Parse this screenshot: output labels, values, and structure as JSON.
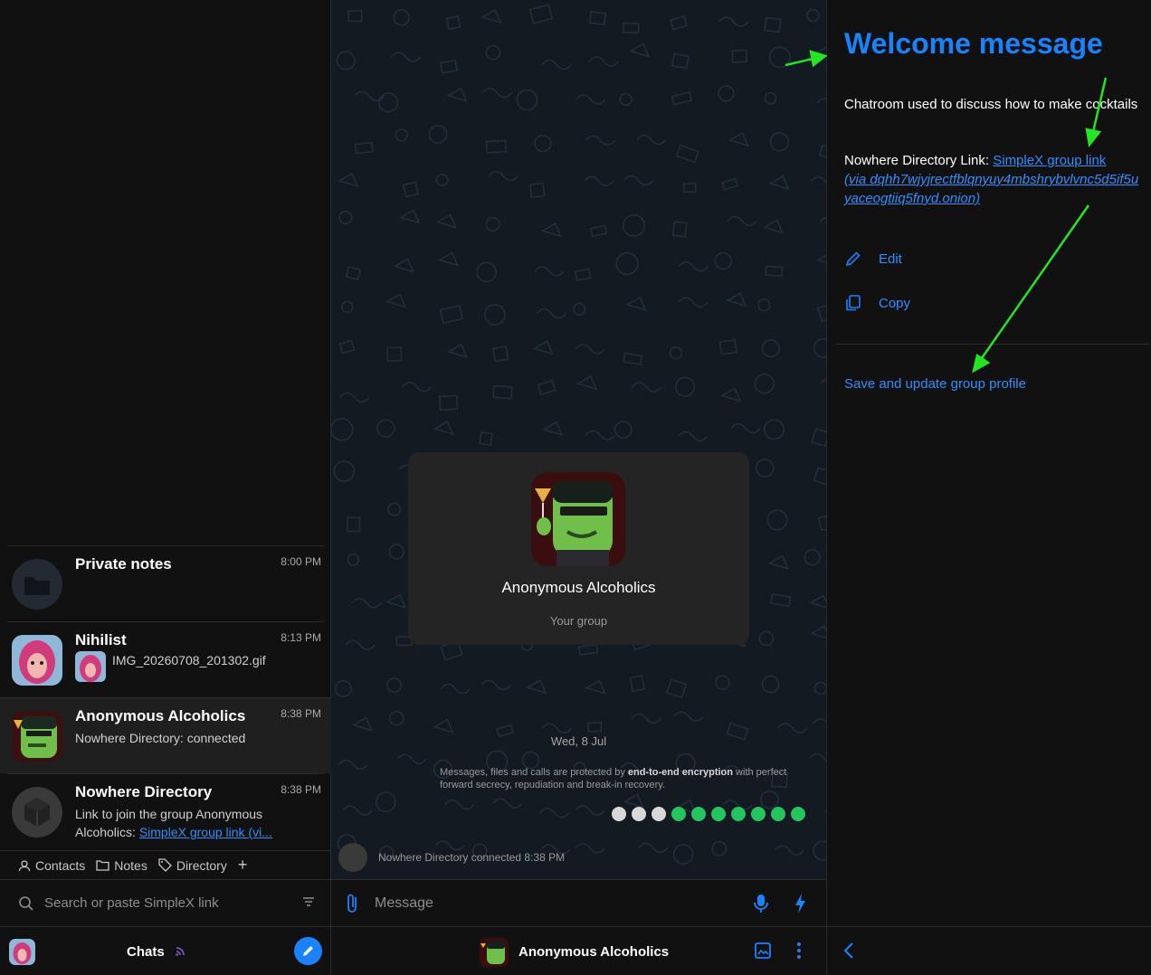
{
  "chats": [
    {
      "name": "Private notes",
      "time": "8:00 PM",
      "preview": "",
      "avatar": "folder-icon"
    },
    {
      "name": "Nihilist",
      "time": "8:13 PM",
      "preview": "IMG_20260708_201302.gif",
      "avatar": "nihilist-avatar"
    },
    {
      "name": "Anonymous Alcoholics",
      "time": "8:38 PM",
      "preview": "Nowhere Directory: connected",
      "avatar": "group-avatar",
      "selected": true
    },
    {
      "name": "Nowhere Directory",
      "time": "8:38 PM",
      "preview_text": "Link to join the group Anonymous Alcoholics: ",
      "preview_link": "SimpleX group link (vi...",
      "avatar": "directory-avatar"
    }
  ],
  "tags": {
    "contacts": "Contacts",
    "notes": "Notes",
    "directory": "Directory",
    "add": "+"
  },
  "search": {
    "placeholder": "Search or paste SimpleX link"
  },
  "left_bottom": {
    "title": "Chats"
  },
  "group_card": {
    "name": "Anonymous Alcoholics",
    "subtitle": "Your group"
  },
  "date_separator": "Wed, 8 Jul",
  "e2e": {
    "prefix": "Messages, files and calls are protected by ",
    "bold": "end-to-end encryption",
    "suffix": " with perfect forward secrecy, repudiation and break-in recovery."
  },
  "connected_event": "Nowhere Directory connected  8:38 PM",
  "compose": {
    "placeholder": "Message"
  },
  "chat_header": {
    "title": "Anonymous Alcoholics"
  },
  "welcome": {
    "title": "Welcome message",
    "text": "Chatroom used to discuss how to make cocktails",
    "dir_label": "Nowhere Directory Link: ",
    "dir_link": "SimpleX group link",
    "dir_link_detail": "(via dqhh7wjyjrectfblqnyuy4mbshrybvlvnc5d5if5uyaceogtiiq5fnyd.onion)",
    "edit": "Edit",
    "copy": "Copy",
    "save": "Save and update group profile"
  },
  "colors": {
    "accent": "#1a82ff",
    "annotation_arrow": "#22e622"
  },
  "feature_icon_colors": [
    "#d8d8d8",
    "#d8d8d8",
    "#d8d8d8",
    "#22c55e",
    "#22c55e",
    "#22c55e",
    "#22c55e",
    "#22c55e",
    "#22c55e",
    "#22c55e"
  ]
}
